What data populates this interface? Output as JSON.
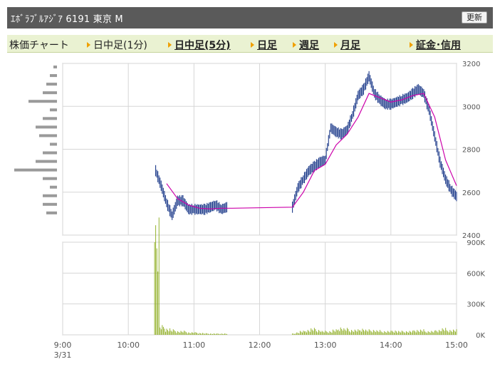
{
  "header": {
    "title": "ｴﾎﾞﾗﾌﾞﾙｱｼﾞｱ  6191  東京 M",
    "refresh_label": "更新"
  },
  "tabs": [
    {
      "label": "株価チャート",
      "arrow": false,
      "link": false
    },
    {
      "label": "日中足(1分)",
      "arrow": true,
      "link": false
    },
    {
      "label": "日中足(5分)",
      "arrow": true,
      "link": true
    },
    {
      "label": "日足",
      "arrow": true,
      "link": true
    },
    {
      "label": "週足",
      "arrow": true,
      "link": true
    },
    {
      "label": "月足",
      "arrow": true,
      "link": true
    },
    {
      "label": "証金･信用",
      "arrow": true,
      "link": true
    }
  ],
  "colors": {
    "candle": "#1c3a8a",
    "moving_average": "#cc00aa",
    "volume": "#8aaa1a",
    "profile": "#9a9a9a",
    "grid": "#d6d6d6"
  },
  "chart_data": [
    {
      "type": "line",
      "name": "intraday-price",
      "x_ticks": [
        "9:00",
        "10:00",
        "11:00",
        "12:00",
        "13:00",
        "14:00",
        "15:00"
      ],
      "x_subtick": "3/31",
      "y_ticks": [
        2400,
        2600,
        2800,
        3000,
        3200
      ],
      "ylim": [
        2400,
        3200
      ],
      "grid": true,
      "series": [
        {
          "style": "price-bars",
          "x": [
            "10:25",
            "10:30",
            "10:35",
            "10:40",
            "10:45",
            "10:50",
            "10:55",
            "11:00",
            "11:05",
            "11:10",
            "11:15",
            "11:20",
            "11:25",
            "11:30",
            "12:30",
            "12:35",
            "12:40",
            "12:45",
            "12:50",
            "12:55",
            "13:00",
            "13:05",
            "13:10",
            "13:15",
            "13:20",
            "13:25",
            "13:30",
            "13:35",
            "13:40",
            "13:45",
            "13:50",
            "13:55",
            "14:00",
            "14:05",
            "14:10",
            "14:15",
            "14:20",
            "14:25",
            "14:30",
            "14:35",
            "14:40",
            "14:45",
            "14:50",
            "14:55",
            "15:00"
          ],
          "values": [
            2700,
            2630,
            2550,
            2490,
            2560,
            2560,
            2520,
            2520,
            2520,
            2520,
            2530,
            2540,
            2520,
            2530,
            2530,
            2620,
            2660,
            2700,
            2720,
            2740,
            2750,
            2900,
            2880,
            2870,
            2890,
            2960,
            3050,
            3080,
            3140,
            3060,
            3030,
            3010,
            3010,
            3020,
            3030,
            3040,
            3060,
            3080,
            3060,
            2980,
            2860,
            2740,
            2660,
            2610,
            2580
          ]
        },
        {
          "style": "moving-average",
          "x": [
            "10:35",
            "10:45",
            "10:55",
            "11:05",
            "11:15",
            "11:25",
            "11:35",
            "12:30",
            "12:40",
            "12:50",
            "13:00",
            "13:10",
            "13:20",
            "13:30",
            "13:40",
            "13:50",
            "14:00",
            "14:10",
            "14:20",
            "14:30",
            "14:40",
            "14:50",
            "15:00"
          ],
          "values": [
            2640,
            2570,
            2540,
            2525,
            2522,
            2525,
            2525,
            2530,
            2600,
            2700,
            2730,
            2820,
            2870,
            2950,
            3060,
            3040,
            3020,
            3030,
            3050,
            3060,
            2950,
            2750,
            2630
          ]
        }
      ]
    },
    {
      "type": "bar",
      "name": "intraday-volume",
      "x_ticks": [
        "9:00",
        "10:00",
        "11:00",
        "12:00",
        "13:00",
        "14:00",
        "15:00"
      ],
      "y_ticks": [
        "0K",
        "300K",
        "600K",
        "900K"
      ],
      "ylim": [
        0,
        900
      ],
      "y_unit": "K",
      "first_bar_time": "10:24",
      "last_bar_time": "15:00",
      "gap": [
        "11:30",
        "12:30"
      ],
      "values": [
        900,
        70,
        50,
        40,
        30,
        30,
        20,
        20,
        15,
        12,
        10,
        10,
        10,
        10,
        20,
        30,
        40,
        50,
        40,
        30,
        30,
        40,
        60,
        50,
        40,
        40,
        50,
        40,
        40,
        35,
        30,
        30,
        35,
        30,
        30,
        30,
        40,
        40,
        30,
        30,
        40,
        50,
        40,
        40,
        40
      ]
    },
    {
      "type": "bar",
      "name": "price-volume-profile",
      "orientation": "horizontal",
      "price_levels": [
        3180,
        3140,
        3100,
        3060,
        3020,
        2980,
        2940,
        2900,
        2860,
        2820,
        2780,
        2740,
        2700,
        2660,
        2620,
        2580,
        2540,
        2500
      ],
      "values": [
        5,
        10,
        15,
        20,
        40,
        10,
        20,
        30,
        25,
        10,
        20,
        30,
        60,
        20,
        10,
        20,
        20,
        15
      ]
    }
  ]
}
